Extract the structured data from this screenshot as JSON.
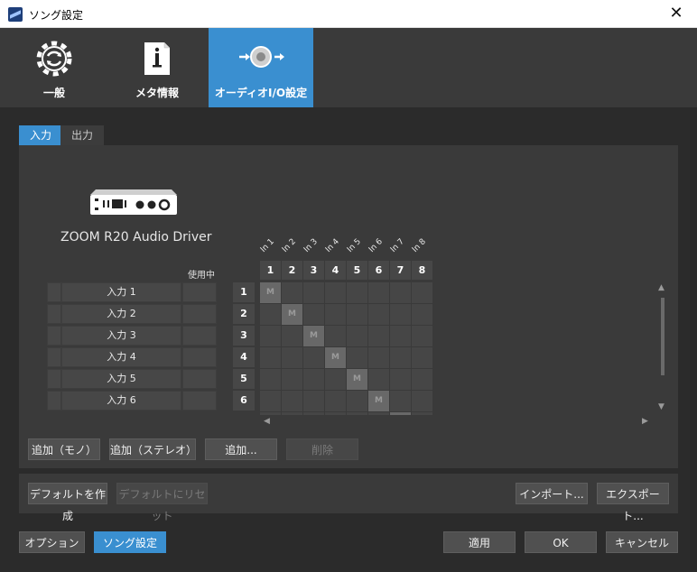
{
  "window": {
    "title": "ソング設定",
    "close": "✕"
  },
  "categories": [
    {
      "label": "一般",
      "icon": "gear-refresh-icon"
    },
    {
      "label": "メタ情報",
      "icon": "info-document-icon"
    },
    {
      "label": "オーディオI/O設定",
      "icon": "speaker-io-icon"
    }
  ],
  "subtabs": {
    "input": "入力",
    "output": "出力"
  },
  "device": {
    "name": "ZOOM R20 Audio Driver",
    "in_use_header": "使用中"
  },
  "inputs": [
    {
      "num": "1",
      "label": "入力 1"
    },
    {
      "num": "2",
      "label": "入力 2"
    },
    {
      "num": "3",
      "label": "入力 3"
    },
    {
      "num": "4",
      "label": "入力 4"
    },
    {
      "num": "5",
      "label": "入力 5"
    },
    {
      "num": "6",
      "label": "入力 6"
    }
  ],
  "columns": [
    {
      "num": "1",
      "name": "In 1"
    },
    {
      "num": "2",
      "name": "In 2"
    },
    {
      "num": "3",
      "name": "In 3"
    },
    {
      "num": "4",
      "name": "In 4"
    },
    {
      "num": "5",
      "name": "In 5"
    },
    {
      "num": "6",
      "name": "In 6"
    },
    {
      "num": "7",
      "name": "In 7"
    },
    {
      "num": "8",
      "name": "In 8"
    }
  ],
  "matrix_marker": "M",
  "buttons": {
    "add_mono": "追加（モノ）",
    "add_stereo": "追加（ステレオ）",
    "add": "追加...",
    "delete": "削除",
    "make_default": "デフォルトを作成",
    "reset_default": "デフォルトにリセット",
    "import": "インポート...",
    "export": "エクスポート...",
    "options": "オプション",
    "song_settings": "ソング設定",
    "apply": "適用",
    "ok": "OK",
    "cancel": "キャンセル"
  }
}
